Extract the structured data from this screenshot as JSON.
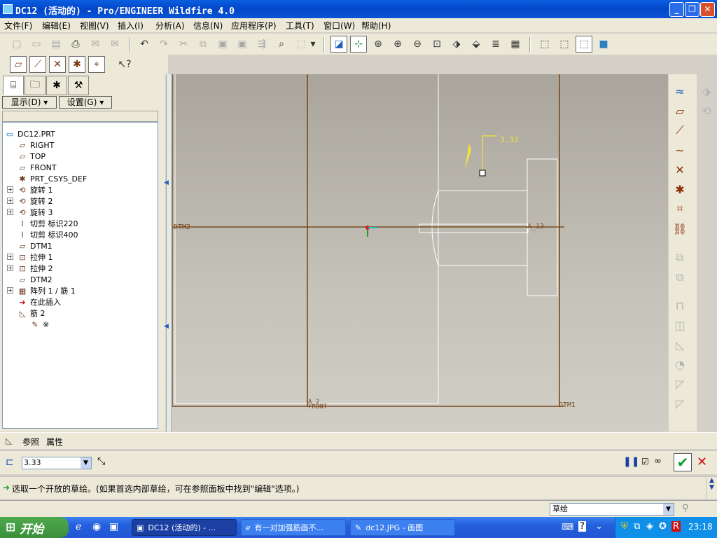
{
  "window": {
    "title": "DC12 (活动的) - Pro/ENGINEER Wildfire 4.0"
  },
  "menu": [
    "文件(F)",
    "编辑(E)",
    "视图(V)",
    "插入(I)",
    "分析(A)",
    "信息(N)",
    "应用程序(P)",
    "工具(T)",
    "窗口(W)",
    "帮助(H)"
  ],
  "panel": {
    "show_label": "显示(D)",
    "settings_label": "设置(G)"
  },
  "tree": [
    {
      "label": "DC12.PRT",
      "icon": "part-icon",
      "glyph": "▭",
      "expand": false
    },
    {
      "label": "RIGHT",
      "icon": "datum-plane-icon",
      "glyph": "▱",
      "expand": false
    },
    {
      "label": "TOP",
      "icon": "datum-plane-icon",
      "glyph": "▱",
      "expand": false
    },
    {
      "label": "FRONT",
      "icon": "datum-plane-icon",
      "glyph": "▱",
      "expand": false
    },
    {
      "label": "PRT_CSYS_DEF",
      "icon": "csys-icon",
      "glyph": "✱",
      "expand": false
    },
    {
      "label": "旋转 1",
      "icon": "revolve-icon",
      "glyph": "⟲",
      "expand": true
    },
    {
      "label": "旋转 2",
      "icon": "revolve-icon",
      "glyph": "⟲",
      "expand": true
    },
    {
      "label": "旋转 3",
      "icon": "revolve-icon",
      "glyph": "⟲",
      "expand": true
    },
    {
      "label": "切剪 标识220",
      "icon": "cut-icon",
      "glyph": "⌇",
      "expand": false
    },
    {
      "label": "切剪 标识400",
      "icon": "cut-icon",
      "glyph": "⌇",
      "expand": false
    },
    {
      "label": "DTM1",
      "icon": "datum-plane-icon",
      "glyph": "▱",
      "expand": false
    },
    {
      "label": "拉伸 1",
      "icon": "extrude-icon",
      "glyph": "⊡",
      "expand": true
    },
    {
      "label": "拉伸 2",
      "icon": "extrude-icon",
      "glyph": "⊡",
      "expand": true
    },
    {
      "label": "DTM2",
      "icon": "datum-plane-icon",
      "glyph": "▱",
      "expand": false
    },
    {
      "label": "阵列 1 / 筋 1",
      "icon": "pattern-icon",
      "glyph": "▦",
      "expand": true
    },
    {
      "label": "在此插入",
      "icon": "insert-here-arrow-icon",
      "glyph": "➜",
      "expand": false
    },
    {
      "label": "筋 2",
      "icon": "rib-icon",
      "glyph": "◺",
      "expand": false
    },
    {
      "label": "※",
      "icon": "sketch-icon",
      "glyph": "✎",
      "expand": false
    }
  ],
  "viewport": {
    "dim_value": "3.33",
    "datum_left": "DTM2",
    "datum_axis": "A_13",
    "datum_bottom_left": "A_2",
    "datum_bottom_left2": "FRONT",
    "datum_bottom_right": "DTM1"
  },
  "refbar": {
    "ref_label": "参照",
    "prop_label": "属性"
  },
  "dash": {
    "thickness_value": "3.33"
  },
  "message": {
    "text": "选取一个开放的草绘。(如果首选内部草绘，可在参照面板中找到\"编辑\"选项。)"
  },
  "status": {
    "filter_value": "草绘"
  },
  "taskbar": {
    "start_label": "开始",
    "tasks": [
      "DC12 (活动的) - ...",
      "有一对加强筋画不...",
      "dc12.JPG - 画图"
    ],
    "clock": "23:18"
  },
  "colors": {
    "datum": "#7a4a1e",
    "dimension": "#f4e23a",
    "title_bar": "#0a53d8",
    "taskbar": "#245edb"
  }
}
